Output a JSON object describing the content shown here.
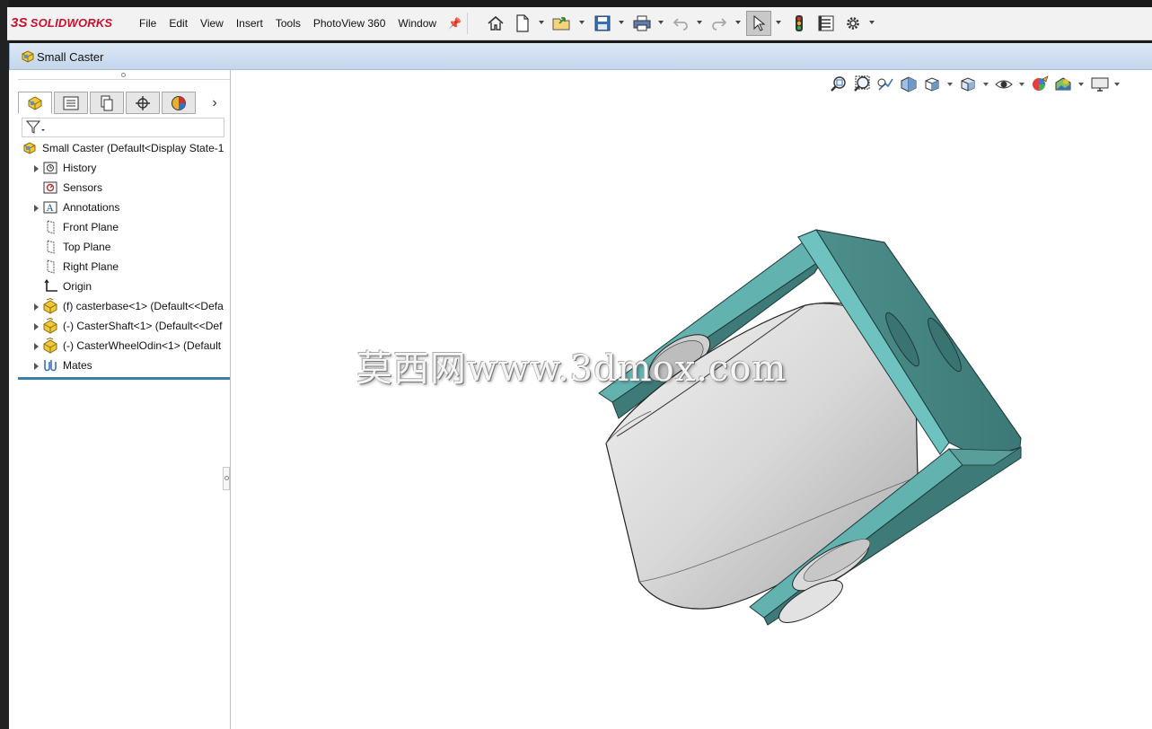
{
  "app": {
    "logo_prefix": "3S",
    "logo_text": "SOLIDWORKS"
  },
  "menus": [
    "File",
    "Edit",
    "View",
    "Insert",
    "Tools",
    "PhotoView 360",
    "Window"
  ],
  "toolbar": {
    "icons": [
      "home-icon",
      "new-document-icon",
      "open-icon",
      "save-icon",
      "print-icon",
      "undo-icon",
      "redo-icon",
      "select-icon",
      "rebuild-icon",
      "file-properties-icon",
      "options-icon"
    ]
  },
  "document": {
    "title": "Small Caster"
  },
  "feature_manager": {
    "tabs": [
      "featuremanager-tree-tab",
      "property-manager-tab",
      "configuration-manager-tab",
      "dimxpert-manager-tab",
      "display-manager-tab"
    ],
    "tree": {
      "root": "Small Caster  (Default<Display State-1",
      "items": [
        {
          "label": "History",
          "icon": "history-icon",
          "expandable": true
        },
        {
          "label": "Sensors",
          "icon": "sensors-icon",
          "expandable": false
        },
        {
          "label": "Annotations",
          "icon": "annotations-icon",
          "expandable": true
        },
        {
          "label": "Front Plane",
          "icon": "plane-icon",
          "expandable": false
        },
        {
          "label": "Top Plane",
          "icon": "plane-icon",
          "expandable": false
        },
        {
          "label": "Right Plane",
          "icon": "plane-icon",
          "expandable": false
        },
        {
          "label": "Origin",
          "icon": "origin-icon",
          "expandable": false
        },
        {
          "label": "(f) casterbase<1> (Default<<Defa",
          "icon": "part-icon",
          "expandable": true
        },
        {
          "label": "(-) CasterShaft<1> (Default<<Def",
          "icon": "part-icon",
          "expandable": true
        },
        {
          "label": "(-) CasterWheelOdin<1> (Default",
          "icon": "part-icon",
          "expandable": true
        },
        {
          "label": "Mates",
          "icon": "mates-icon",
          "expandable": true
        }
      ]
    }
  },
  "heads_up_toolbar": {
    "icons": [
      "zoom-to-fit-icon",
      "zoom-to-area-icon",
      "previous-view-icon",
      "section-view-icon",
      "view-orientation-icon",
      "display-style-icon",
      "hide-show-items-icon",
      "edit-appearance-icon",
      "apply-scene-icon",
      "view-settings-icon"
    ]
  },
  "viewport": {
    "watermark": "莫西网www.3dmox.com"
  },
  "colors": {
    "bracket": "#4a8d8a",
    "bracket_edge": "#6ec3c0",
    "wheel": "#d6d6d6",
    "title_gradient": "#c4d6ec",
    "accent_red": "#c8102e"
  }
}
